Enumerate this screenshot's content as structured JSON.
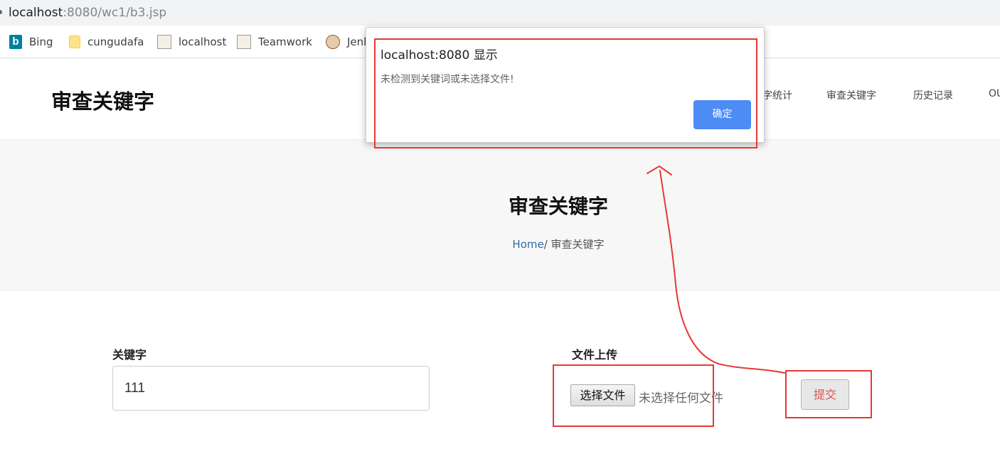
{
  "browser": {
    "url_host": "localhost",
    "url_path": ":8080/wc1/b3.jsp",
    "bookmarks": [
      {
        "label": "Bing",
        "icon": "bing-icon"
      },
      {
        "label": "cungudafa",
        "icon": "folder-icon"
      },
      {
        "label": "localhost",
        "icon": "tomcat-icon"
      },
      {
        "label": "Teamwork",
        "icon": "tomcat-icon"
      },
      {
        "label": "Jenk",
        "icon": "jenkins-icon"
      }
    ]
  },
  "header": {
    "brand": "审查关键字",
    "nav": [
      "字统计",
      "审查关键字",
      "历史记录",
      "OU"
    ]
  },
  "hero": {
    "title": "审查关键字",
    "breadcrumb_home": "Home",
    "breadcrumb_sep": "/ ",
    "breadcrumb_current": "审查关键字"
  },
  "form": {
    "keyword_label": "关键字",
    "keyword_value": "111",
    "file_label": "文件上传",
    "file_button": "选择文件",
    "file_status": "未选择任何文件",
    "submit": "提交"
  },
  "dialog": {
    "title": "localhost:8080 显示",
    "message": "未检测到关键词或未选择文件!",
    "ok": "确定"
  },
  "colors": {
    "annotation": "#e53935",
    "dialog_button": "#4d8bf5",
    "breadcrumb_link": "#2b6ca3"
  }
}
